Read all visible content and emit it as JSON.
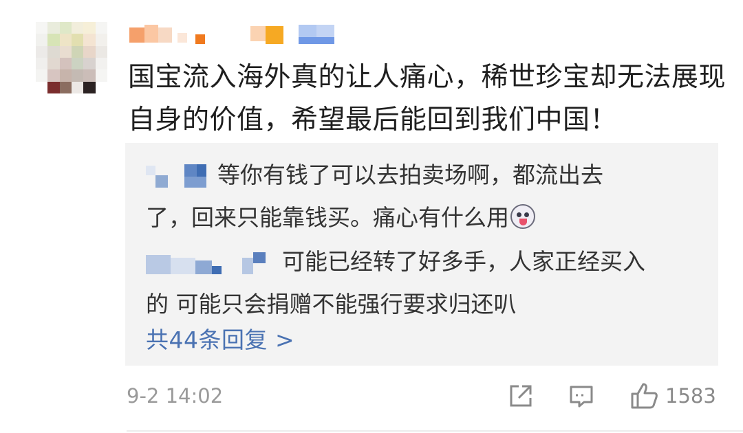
{
  "comment": {
    "text_line1": "国宝流入海外真的让人痛心，稀世珍宝却无法展现",
    "text_line2": "自身的价值，希望最后能回到我们中国！"
  },
  "replies": [
    {
      "text_line1": "等你有钱了可以去拍卖场啊，都流出去",
      "text_line2": "了，回来只能靠钱买。痛心有什么用"
    },
    {
      "text_line1": "可能已经转了好多手，人家正经买入",
      "text_line2": "的 可能只会捐赠不能强行要求归还叭"
    }
  ],
  "more_replies_label": "共44条回复 >",
  "footer": {
    "timestamp": "9-2 14:02",
    "like_count": "1583"
  },
  "icons": {
    "share": "share-icon",
    "reply": "comment-icon",
    "like": "thumbs-up-icon"
  },
  "colors": {
    "link": "#4a72b2",
    "reply_background": "#f3f3f3",
    "muted": "#9a9a9a"
  }
}
